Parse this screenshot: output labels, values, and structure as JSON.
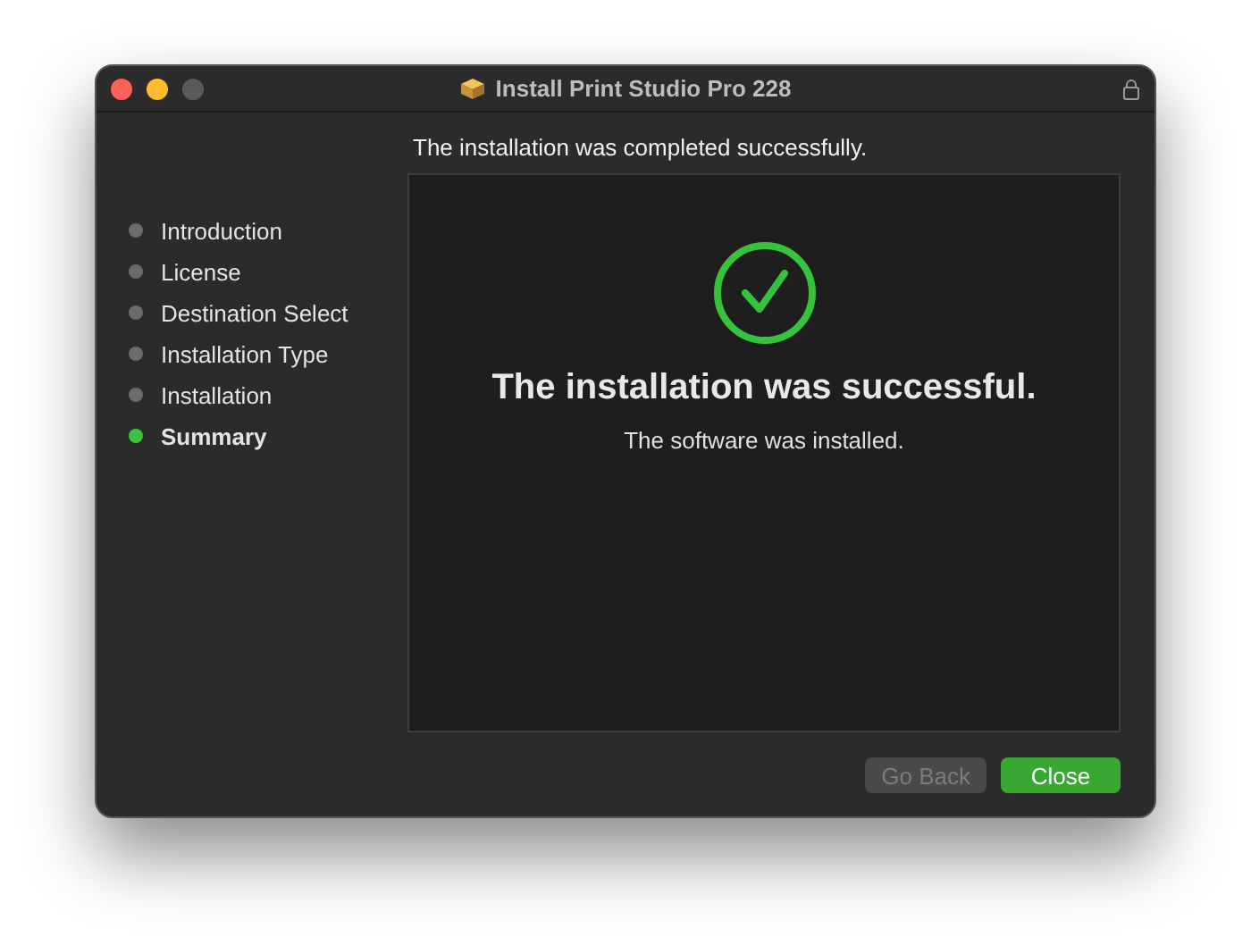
{
  "window": {
    "title": "Install Print Studio Pro 228"
  },
  "heading": "The installation was completed successfully.",
  "steps": [
    {
      "label": "Introduction",
      "selected": false
    },
    {
      "label": "License",
      "selected": false
    },
    {
      "label": "Destination Select",
      "selected": false
    },
    {
      "label": "Installation Type",
      "selected": false
    },
    {
      "label": "Installation",
      "selected": false
    },
    {
      "label": "Summary",
      "selected": true
    }
  ],
  "result": {
    "title": "The installation was successful.",
    "message": "The software was installed."
  },
  "buttons": [
    {
      "label": "Go Back",
      "disabled": true,
      "primary": false
    },
    {
      "label": "Close",
      "disabled": false,
      "primary": true
    }
  ]
}
